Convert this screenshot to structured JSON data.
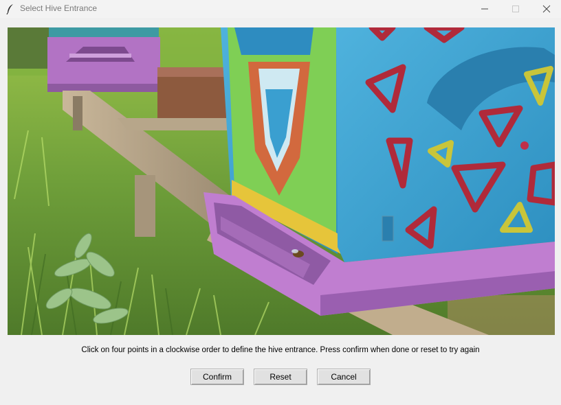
{
  "window": {
    "title": "Select Hive Entrance",
    "controls": {
      "minimize": "minimize-icon",
      "maximize": "maximize-icon",
      "close": "close-icon"
    }
  },
  "image": {
    "subject": "photo of a beehive entrance"
  },
  "instruction": "Click on four points in a clockwise order to define the hive entrance. Press confirm when done or reset to try again",
  "buttons": {
    "confirm": "Confirm",
    "reset": "Reset",
    "cancel": "Cancel"
  },
  "colors": {
    "hive_blue": "#3aa0cf",
    "hive_green": "#7fcf55",
    "hive_purple": "#b06fc0",
    "window_bg": "#f0f0f0"
  }
}
